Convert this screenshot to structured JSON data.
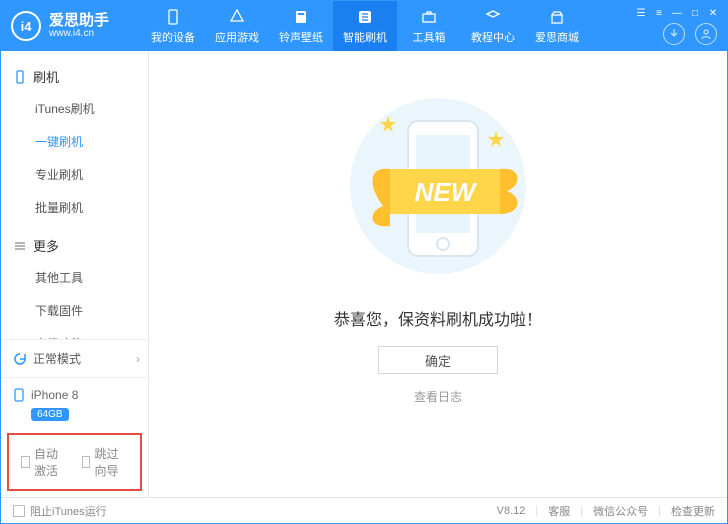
{
  "header": {
    "logo_initials": "i4",
    "logo_cn": "爱思助手",
    "logo_url": "www.i4.cn",
    "nav": [
      {
        "label": "我的设备"
      },
      {
        "label": "应用游戏"
      },
      {
        "label": "铃声壁纸"
      },
      {
        "label": "智能刷机"
      },
      {
        "label": "工具箱"
      },
      {
        "label": "教程中心"
      },
      {
        "label": "爱思商城"
      }
    ]
  },
  "sidebar": {
    "group1": {
      "title": "刷机",
      "items": [
        "iTunes刷机",
        "一键刷机",
        "专业刷机",
        "批量刷机"
      ]
    },
    "group2": {
      "title": "更多",
      "items": [
        "其他工具",
        "下载固件",
        "高级功能"
      ]
    },
    "status": "正常模式",
    "device_name": "iPhone 8",
    "device_cap": "64GB",
    "opt1": "自动激活",
    "opt2": "跳过向导"
  },
  "main": {
    "banner": "NEW",
    "success": "恭喜您，保资料刷机成功啦！",
    "ok": "确定",
    "log": "查看日志"
  },
  "footer": {
    "block": "阻止iTunes运行",
    "version": "V8.12",
    "right": [
      "客服",
      "微信公众号",
      "检查更新"
    ]
  }
}
